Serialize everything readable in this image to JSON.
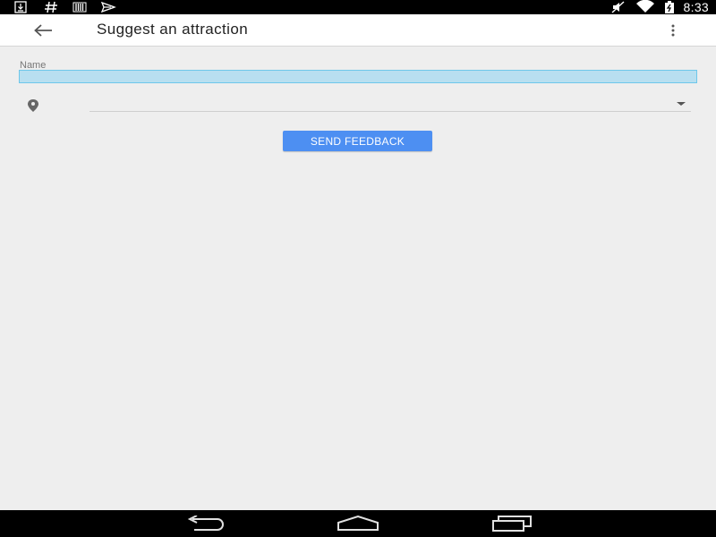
{
  "status_bar": {
    "time": "8:33",
    "left_icons": [
      "download-icon",
      "hash-icon",
      "barcode-icon",
      "send-icon"
    ],
    "right_icons": [
      "mute-icon",
      "wifi-icon",
      "battery-icon"
    ]
  },
  "app_bar": {
    "title": "Suggest an attraction",
    "back_icon": "arrow-back-icon",
    "overflow_icon": "more-vert-icon"
  },
  "form": {
    "name_label": "Name",
    "name_value": "",
    "place_value": "",
    "place_icon": "map-marker-icon",
    "submit_label": "SEND FEEDBACK"
  },
  "colors": {
    "accent": "#4d8ff2",
    "input_highlight": "#b8dff0",
    "background": "#eeeeee"
  },
  "nav_bar": {
    "icons": [
      "back-icon",
      "home-icon",
      "recents-icon"
    ]
  }
}
